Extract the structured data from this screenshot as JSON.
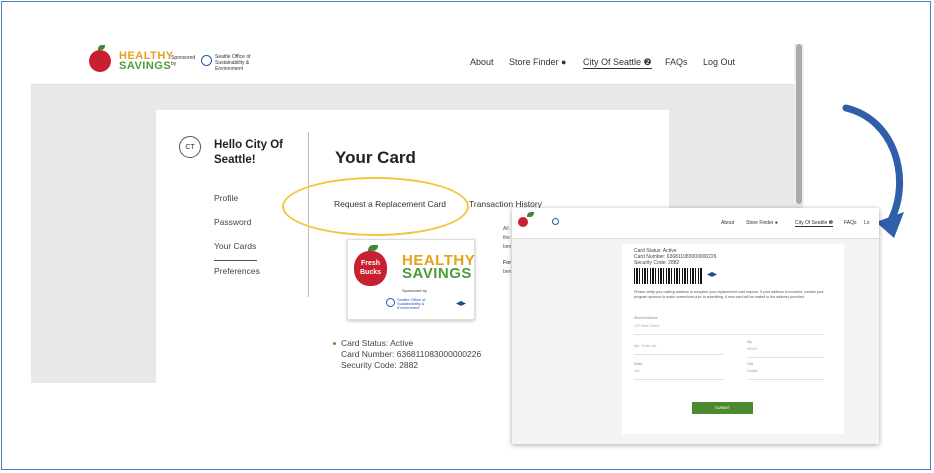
{
  "main": {
    "brand_line1": "HEALTHY",
    "brand_line2": "SAVINGS",
    "sponsored_by": "Sponsored by",
    "sponsor_name": "Seattle Office of Sustainability & Environment",
    "nav": {
      "about": "About",
      "store_finder": "Store Finder",
      "city": "City Of Seattle",
      "faqs": "FAQs",
      "logout": "Log Out"
    },
    "avatar_initials": "CT",
    "greeting": "Hello City Of Seattle!",
    "menu": [
      "Profile",
      "Password",
      "Your Cards",
      "Preferences"
    ],
    "page_title": "Your Card",
    "actions": {
      "request_replacement": "Request a Replacement Card",
      "transaction_history": "Transaction History"
    },
    "card_image": {
      "fresh_bucks": "Fresh Bucks",
      "line1": "HEALTHY",
      "line2": "SAVINGS",
      "sponsored_by": "Sponsored by",
      "sponsor_name": "Seattle Office of Sustainability & Environment"
    },
    "card_status": "Card Status: Active",
    "card_number": "Card Number: 636811083000000226",
    "security_code": "Security Code: 2882",
    "partial_hidden": [
      "All",
      "the",
      "ben",
      "For",
      "ben"
    ]
  },
  "inset": {
    "nav": {
      "about": "About",
      "store_finder": "Store Finder",
      "city": "City Of Seattle",
      "faqs": "FAQs",
      "logout": "Lo"
    },
    "card_status": "Card Status: Active",
    "card_number": "Card Number: 636811083000000226",
    "security_code": "Security Code: 2882",
    "instructions": "Please verify your mailing address to complete your replacement card request. If your address is incorrect, contact your program sponsor to make corrections prior to submitting. A new card will be mailed to the address provided.",
    "fields": {
      "street_label": "Street Address",
      "street_value": "123 Main Street",
      "apt_label": "Apt, Suite, etc",
      "zip_label": "Zip",
      "zip_value": "98104",
      "state_label": "State",
      "state_value": "WA",
      "city_label": "City",
      "city_value": "Seattle"
    },
    "submit_label": "SUBMIT"
  },
  "colors": {
    "frame_border": "#4f7fbf",
    "highlight_ellipse": "#f0c63c",
    "arrow": "#2f5fa8",
    "submit_button": "#4b8a2e"
  }
}
